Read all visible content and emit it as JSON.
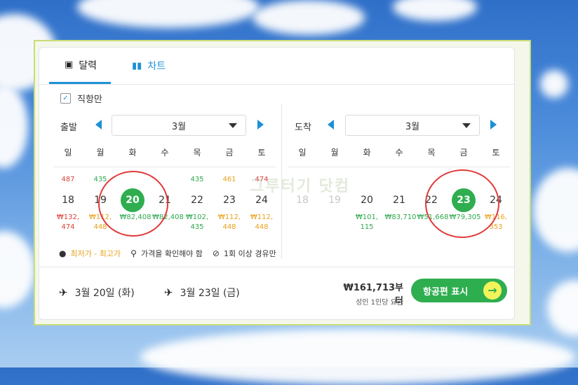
{
  "tabs": {
    "calendar": "달력",
    "chart": "차트"
  },
  "direct_only": "직항만",
  "departure": {
    "label": "출발",
    "month": "3월",
    "weekdays": [
      "일",
      "월",
      "화",
      "수",
      "목",
      "금",
      "토"
    ],
    "prev_week_prices": [
      "487",
      "435",
      "",
      "",
      "435",
      "461",
      "474"
    ],
    "days": [
      "18",
      "19",
      "20",
      "21",
      "22",
      "23",
      "24"
    ],
    "prices": [
      "₩132,\n474",
      "₩112,\n448",
      "₩82,408",
      "₩82,408",
      "₩102,\n435",
      "₩112,\n448",
      "₩112,\n448"
    ],
    "selected": "20"
  },
  "arrival": {
    "label": "도착",
    "month": "3월",
    "weekdays": [
      "일",
      "월",
      "화",
      "수",
      "목",
      "금",
      "토"
    ],
    "days": [
      "18",
      "19",
      "20",
      "21",
      "22",
      "23",
      "24"
    ],
    "prices": [
      "",
      "",
      "₩101,\n115",
      "₩83,710",
      "₩51,668",
      "₩79,305",
      "₩116,\n353"
    ],
    "selected": "23"
  },
  "legend": {
    "range": "최저가 - 최고가",
    "check": "가격을 확인해야 함",
    "stopover": "1회 이상 경유만"
  },
  "summary": {
    "out_date": "3월 20일 (화)",
    "in_date": "3월 23일 (금)",
    "price": "₩161,713부터",
    "price_note": "성인 1인당 요금",
    "cta": "항공편 표시"
  },
  "watermark": "그루터기 닷컴",
  "colors": {
    "accent": "#1e90d6",
    "green": "#2fae50",
    "orange": "#e8a21c",
    "red": "#d9413b"
  }
}
